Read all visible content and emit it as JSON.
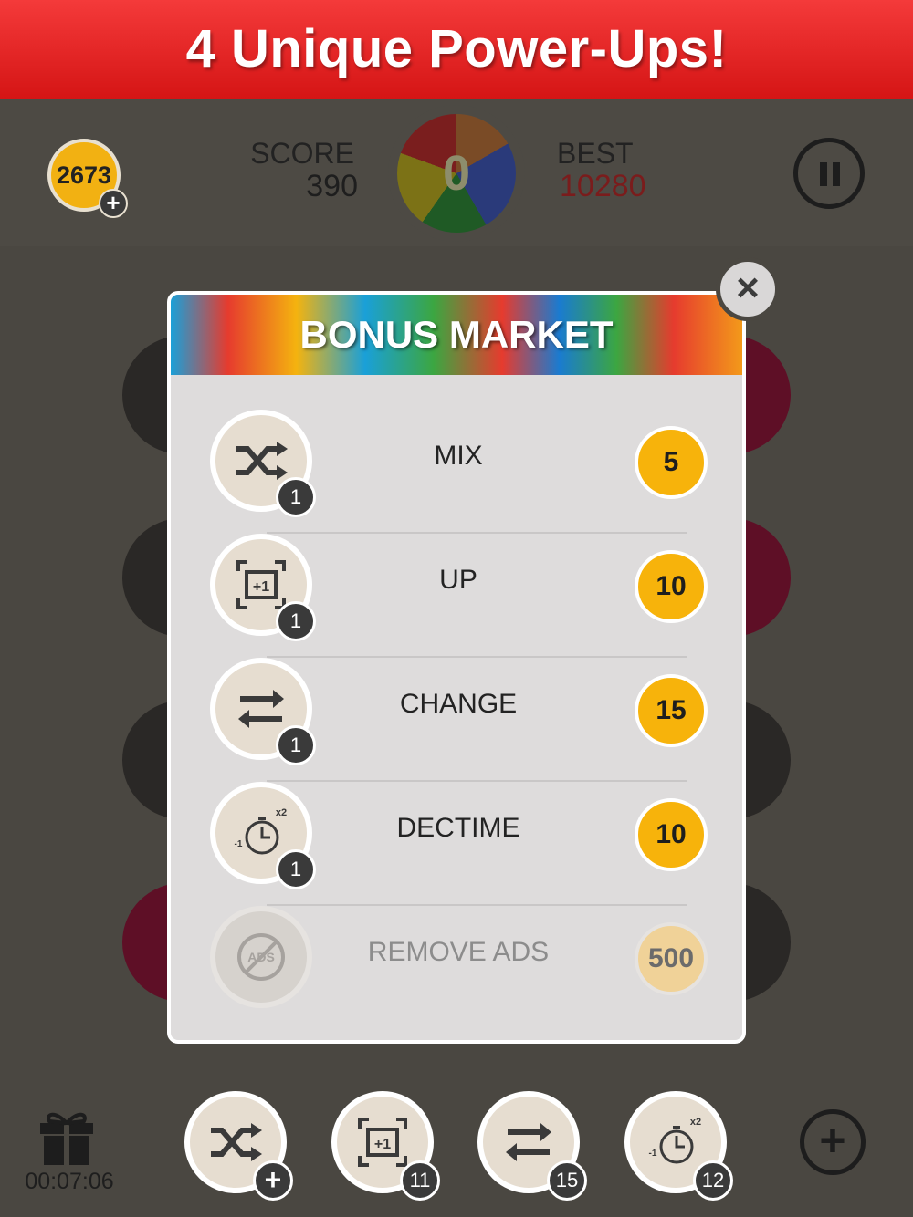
{
  "banner": {
    "title": "4 Unique Power-Ups!"
  },
  "header": {
    "coins": "2673",
    "coins_add": "+",
    "score_label": "SCORE",
    "score_value": "390",
    "best_label": "BEST",
    "best_value": "10280",
    "center_number": "0",
    "pause_icon": "pause-icon"
  },
  "modal": {
    "title": "BONUS MARKET",
    "close": "×",
    "items": [
      {
        "icon": "shuffle-icon",
        "count": "1",
        "label": "MIX",
        "price": "5"
      },
      {
        "icon": "plus-one-icon",
        "count": "1",
        "label": "UP",
        "price": "10"
      },
      {
        "icon": "swap-arrows-icon",
        "count": "1",
        "label": "CHANGE",
        "price": "15"
      },
      {
        "icon": "stopwatch-icon",
        "count": "1",
        "label": "DECTIME",
        "price": "10"
      },
      {
        "icon": "no-ads-icon",
        "label": "REMOVE ADS",
        "price": "500",
        "disabled": true
      }
    ]
  },
  "footer": {
    "gift_icon": "gift-icon",
    "timer": "00:07:06",
    "powerups": [
      {
        "icon": "shuffle-icon",
        "badge": "+"
      },
      {
        "icon": "plus-one-icon",
        "badge": "11"
      },
      {
        "icon": "swap-arrows-icon",
        "badge": "15"
      },
      {
        "icon": "stopwatch-icon",
        "badge": "12"
      }
    ],
    "add": "+"
  },
  "colors": {
    "banner": "#e52222",
    "price_coin": "#f7b30b",
    "best_value": "#7a1c1c",
    "background": "#4a4741"
  }
}
